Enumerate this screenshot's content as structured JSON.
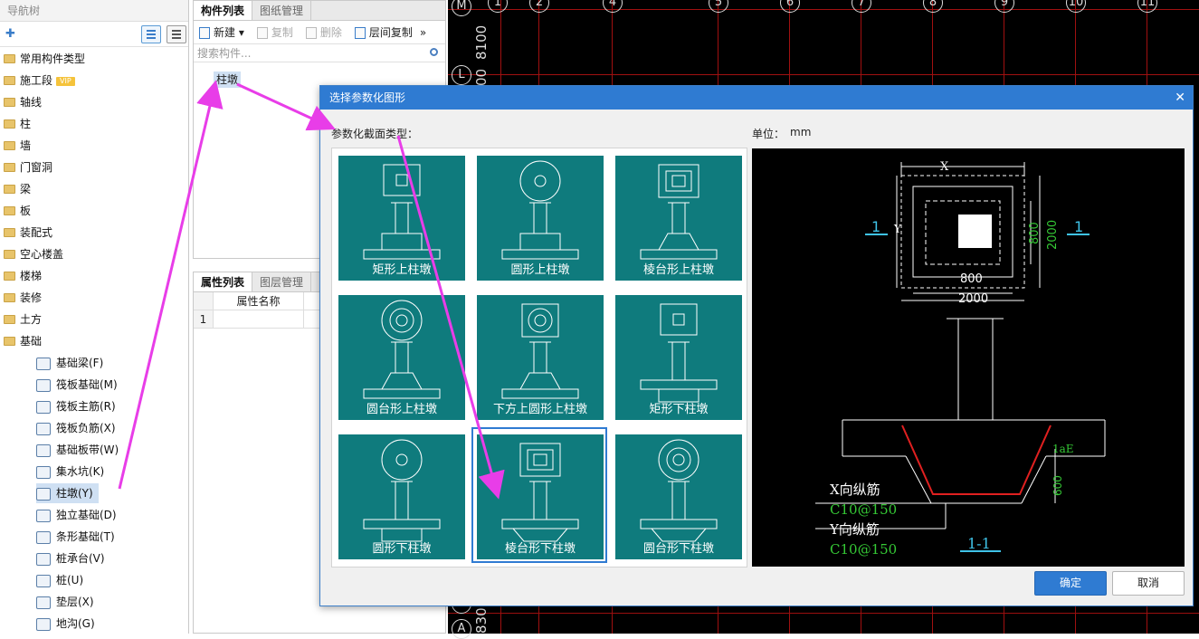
{
  "nav": {
    "title": "导航树",
    "items": [
      {
        "label": "常用构件类型",
        "icon": "folder-icon"
      },
      {
        "label": "施工段",
        "icon": "folder-icon",
        "badge": "VIP"
      },
      {
        "label": "轴线",
        "icon": "folder-icon"
      },
      {
        "label": "柱",
        "icon": "folder-icon"
      },
      {
        "label": "墙",
        "icon": "folder-icon"
      },
      {
        "label": "门窗洞",
        "icon": "folder-icon"
      },
      {
        "label": "梁",
        "icon": "folder-icon"
      },
      {
        "label": "板",
        "icon": "folder-icon"
      },
      {
        "label": "装配式",
        "icon": "folder-icon"
      },
      {
        "label": "空心楼盖",
        "icon": "folder-icon"
      },
      {
        "label": "楼梯",
        "icon": "folder-icon"
      },
      {
        "label": "装修",
        "icon": "folder-icon"
      },
      {
        "label": "土方",
        "icon": "folder-icon"
      },
      {
        "label": "基础",
        "icon": "folder-open-icon"
      }
    ],
    "sub_items": [
      {
        "label": "基础梁(F)",
        "icon": "foundation-beam-icon"
      },
      {
        "label": "筏板基础(M)",
        "icon": "raft-foundation-icon"
      },
      {
        "label": "筏板主筋(R)",
        "icon": "raft-main-rebar-icon"
      },
      {
        "label": "筏板负筋(X)",
        "icon": "raft-negative-rebar-icon"
      },
      {
        "label": "基础板带(W)",
        "icon": "foundation-strip-icon"
      },
      {
        "label": "集水坑(K)",
        "icon": "sump-pit-icon"
      },
      {
        "label": "柱墩(Y)",
        "icon": "column-pier-icon",
        "selected": true
      },
      {
        "label": "独立基础(D)",
        "icon": "isolated-foundation-icon"
      },
      {
        "label": "条形基础(T)",
        "icon": "strip-foundation-icon"
      },
      {
        "label": "桩承台(V)",
        "icon": "pile-cap-icon"
      },
      {
        "label": "桩(U)",
        "icon": "pile-icon"
      },
      {
        "label": "垫层(X)",
        "icon": "cushion-icon"
      },
      {
        "label": "地沟(G)",
        "icon": "trench-icon"
      }
    ]
  },
  "component_panel": {
    "tabs": [
      "构件列表",
      "图纸管理"
    ],
    "toolbar": {
      "new": "新建",
      "copy": "复制",
      "delete": "删除",
      "floor_copy": "层间复制"
    },
    "search_placeholder": "搜索构件...",
    "items": [
      "柱墩"
    ]
  },
  "property_panel": {
    "tabs": [
      "属性列表",
      "图层管理"
    ],
    "header": "属性名称",
    "rows": [
      {
        "index": "1",
        "name": ""
      }
    ]
  },
  "cad": {
    "top_labels": [
      "M",
      "1",
      "2",
      "4",
      "5",
      "6",
      "7",
      "8",
      "9",
      "10",
      "11"
    ],
    "left_labels": [
      "L",
      "D",
      "A"
    ],
    "dims": [
      "8100",
      "00",
      "830"
    ]
  },
  "dialog": {
    "title": "选择参数化图形",
    "section_label": "参数化截面类型：",
    "unit_label": "单位：",
    "unit_value": "mm",
    "shapes": [
      {
        "label": "矩形上柱墩",
        "kind": "rect-top"
      },
      {
        "label": "圆形上柱墩",
        "kind": "circle-top"
      },
      {
        "label": "棱台形上柱墩",
        "kind": "frustum-top"
      },
      {
        "label": "圆台形上柱墩",
        "kind": "cone-top"
      },
      {
        "label": "下方上圆形上柱墩",
        "kind": "square-circle-top"
      },
      {
        "label": "矩形下柱墩",
        "kind": "rect-bottom"
      },
      {
        "label": "圆形下柱墩",
        "kind": "circle-bottom"
      },
      {
        "label": "棱台形下柱墩",
        "kind": "frustum-bottom",
        "selected": true
      },
      {
        "label": "圆台形下柱墩",
        "kind": "cone-bottom"
      }
    ],
    "preview": {
      "x_label": "X",
      "y_label": "Y",
      "dim_800_v": "800",
      "dim_2000_v": "2000",
      "dim_800_h": "800",
      "dim_2000_h": "2000",
      "section_mark": "1",
      "lae": "1aE",
      "depth": "600",
      "x_rebar": "X向纵筋",
      "x_rebar_spec": "C10@150",
      "y_rebar": "Y向纵筋",
      "y_rebar_spec": "C10@150",
      "section_name": "1-1"
    },
    "ok": "确定",
    "cancel": "取消"
  },
  "colors": {
    "accent": "#2f7bd2",
    "tile": "#0f7b7d",
    "arrow": "#e83de8",
    "dim_green": "#35c935",
    "section_cyan": "#3fc3e8"
  }
}
